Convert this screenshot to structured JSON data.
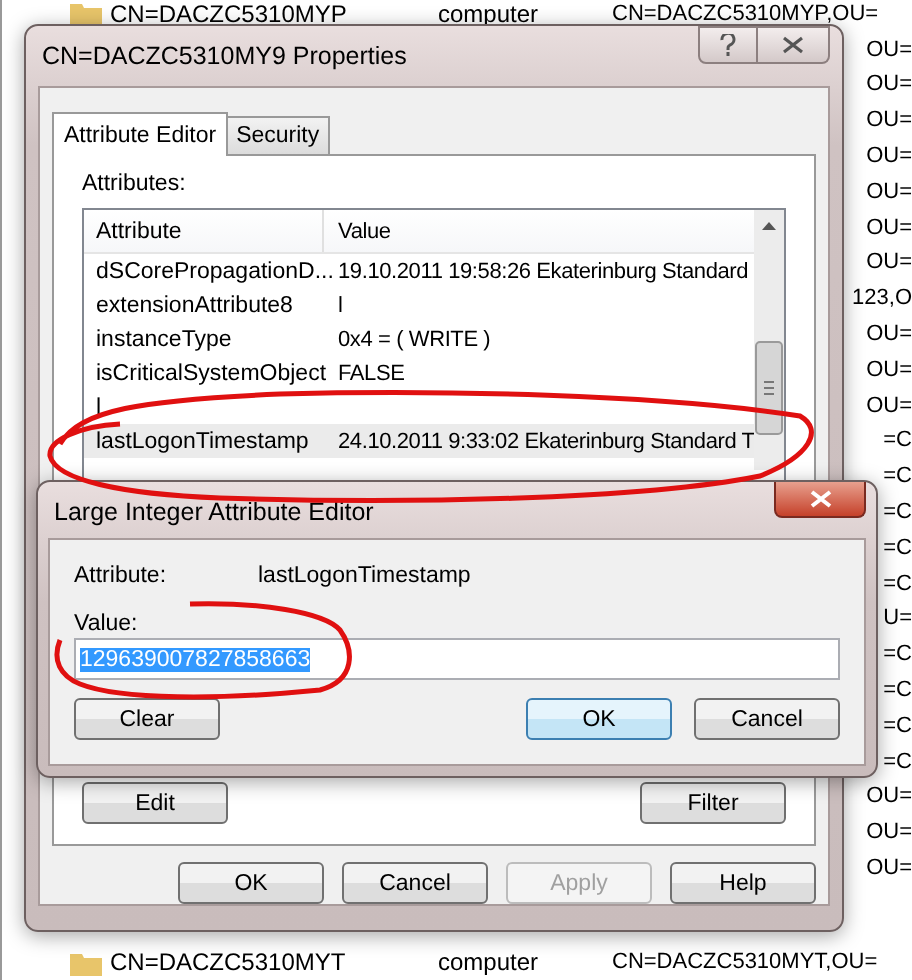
{
  "background_list": {
    "rows": [
      {
        "kind": "full",
        "name": "CN=DACZC5310MYP",
        "type": "computer",
        "dn": "CN=DACZC5310MYP,OU="
      },
      {
        "kind": "fragment",
        "dn": "OU="
      },
      {
        "kind": "fragment",
        "dn": "OU="
      },
      {
        "kind": "fragment",
        "dn": "OU="
      },
      {
        "kind": "fragment",
        "dn": "OU="
      },
      {
        "kind": "fragment",
        "dn": "OU="
      },
      {
        "kind": "fragment",
        "dn": "OU="
      },
      {
        "kind": "fragment",
        "dn": "OU="
      },
      {
        "kind": "fragment",
        "dn": "123,O"
      },
      {
        "kind": "fragment",
        "dn": "OU="
      },
      {
        "kind": "fragment",
        "dn": "OU="
      },
      {
        "kind": "fragment",
        "dn": "OU="
      },
      {
        "kind": "fragment",
        "dn": "=C"
      },
      {
        "kind": "fragment",
        "dn": "=C"
      },
      {
        "kind": "fragment",
        "dn": "=C"
      },
      {
        "kind": "fragment",
        "dn": "=C"
      },
      {
        "kind": "fragment",
        "dn": "=C"
      },
      {
        "kind": "fragment",
        "dn": "U="
      },
      {
        "kind": "fragment",
        "dn": "=C"
      },
      {
        "kind": "fragment",
        "dn": "=C"
      },
      {
        "kind": "fragment",
        "dn": "=C"
      },
      {
        "kind": "fragment",
        "dn": "=C"
      },
      {
        "kind": "fragment",
        "dn": "OU="
      },
      {
        "kind": "fragment",
        "dn": "OU="
      },
      {
        "kind": "fragment",
        "dn": "OU="
      },
      {
        "kind": "full",
        "name": "CN=DACZC5310MYT",
        "type": "computer",
        "dn": "CN=DACZC5310MYT,OU="
      }
    ]
  },
  "properties_dialog": {
    "title": "CN=DACZC5310MY9 Properties",
    "tabs": [
      {
        "label": "Attribute Editor",
        "selected": true
      },
      {
        "label": "Security",
        "selected": false
      }
    ],
    "attributes_label": "Attributes:",
    "columns": [
      "Attribute",
      "Value"
    ],
    "rows": [
      {
        "attribute": "dSCorePropagationD...",
        "value": "19.10.2011 19:58:26 Ekaterinburg Standard",
        "selected": false
      },
      {
        "attribute": "extensionAttribute8",
        "value": "l",
        "selected": false
      },
      {
        "attribute": "instanceType",
        "value": "0x4 = ( WRITE )",
        "selected": false
      },
      {
        "attribute": "isCriticalSystemObject",
        "value": "FALSE",
        "selected": false
      },
      {
        "attribute": "l",
        "selected": false
      },
      {
        "attribute": "lastLogonTimestamp",
        "value": "24.10.2011 9:33:02 Ekaterinburg Standard T",
        "selected": true
      }
    ],
    "list_buttons": [
      {
        "label": "Edit"
      },
      {
        "label": "Filter"
      }
    ],
    "footer_buttons": [
      {
        "label": "OK",
        "disabled": false
      },
      {
        "label": "Cancel",
        "disabled": false
      },
      {
        "label": "Apply",
        "disabled": true
      },
      {
        "label": "Help",
        "disabled": false
      }
    ]
  },
  "editor_dialog": {
    "title": "Large Integer Attribute Editor",
    "attribute_label": "Attribute:",
    "attribute": "lastLogonTimestamp",
    "value_label": "Value:",
    "value": "129639007827858663",
    "buttons": [
      {
        "label": "Clear",
        "default": false
      },
      {
        "label": "OK",
        "default": true
      },
      {
        "label": "Cancel",
        "default": false
      }
    ]
  }
}
